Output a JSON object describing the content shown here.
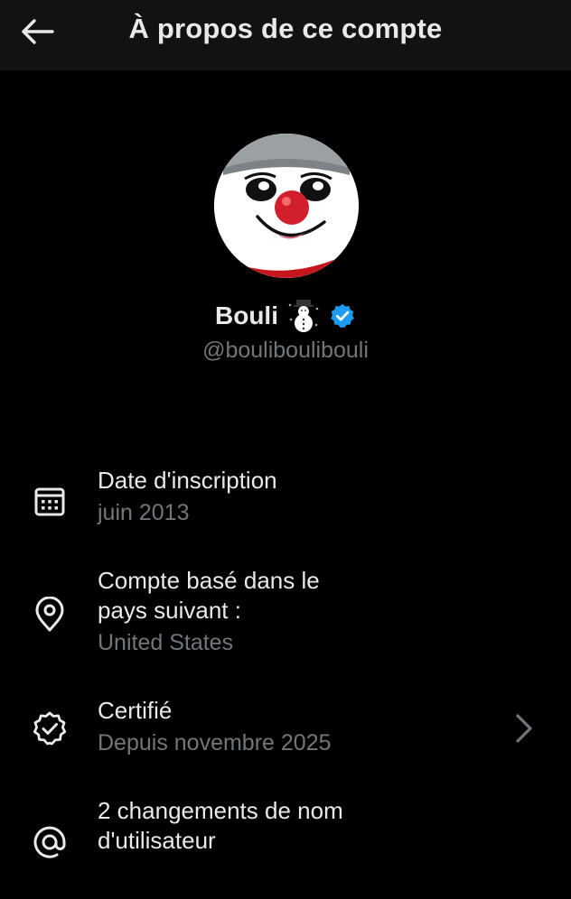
{
  "header": {
    "title": "À propos de ce compte",
    "back_icon": "arrow-left-icon"
  },
  "profile": {
    "name": "Bouli",
    "name_emoji": "snowman-emoji",
    "verified_icon": "verified-badge-icon",
    "verified_color": "#1d9bf0",
    "handle": "@boulibouliboul‌i"
  },
  "info": {
    "join": {
      "icon": "calendar-icon",
      "title": "Date d'inscription",
      "value": "juin 2013"
    },
    "location": {
      "icon": "location-pin-icon",
      "title_line1": "Compte basé dans le",
      "title_line2": "pays suivant :",
      "value": "United States"
    },
    "verified": {
      "icon": "verified-seal-icon",
      "title": "Certifié",
      "value": "Depuis novembre 2025",
      "chevron_icon": "chevron-right-icon"
    },
    "username_changes": {
      "icon": "at-sign-icon",
      "title_line1": "2 changements de nom",
      "title_line2": "d'utilisateur"
    }
  },
  "colors": {
    "background": "#000000",
    "header_background": "#111214",
    "primary_text": "#e7e9ea",
    "secondary_text": "#71767b",
    "accent": "#1d9bf0"
  }
}
